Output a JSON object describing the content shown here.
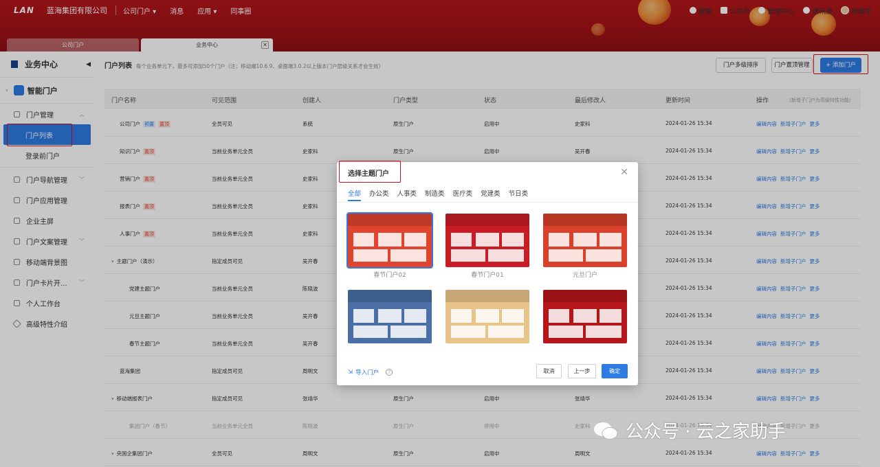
{
  "header": {
    "logo": "LAN",
    "company": "蓝海集团有限公司",
    "nav": [
      "公司门户 ▾",
      "消息",
      "应用 ▾",
      "同事圈"
    ],
    "right": {
      "search": "搜索",
      "public": "公共号",
      "admin": "管理中心",
      "contacts": "通讯录",
      "user": "杨瀚宇"
    },
    "tabs": {
      "company_portal": "公司门户",
      "business_center": "业务中心"
    }
  },
  "sidebar": {
    "title": "业务中心",
    "app": "智能门户",
    "portal_mgmt": "门户管理",
    "portal_list": "门户列表",
    "login_portal": "登录前门户",
    "items": [
      "门户导航管理",
      "门户应用管理",
      "企业主屏",
      "门户文案管理",
      "移动端背景图",
      "门户卡片开...",
      "个人工作台",
      "高级特性介绍"
    ]
  },
  "main": {
    "title": "门户列表",
    "note": "每个业务单元下，最多可添加50个门户（注：移动端10.6.9、桌面端3.0.2以上版本门户层级关系才会生效）",
    "btn_sort": "门户多级排序",
    "btn_top": "门户置顶管理",
    "btn_add": "+ 添加门户",
    "columns": [
      "门户名称",
      "可见范围",
      "创建人",
      "门户类型",
      "状态",
      "最后修改人",
      "更新时间",
      "操作"
    ],
    "ops_note": "（新增子门户为高级特性功能）",
    "actions": [
      "编辑内容",
      "新增子门户",
      "更多"
    ],
    "rows": [
      {
        "name": "公司门户",
        "tags": [
          "预置",
          "置顶"
        ],
        "scope": "全员可见",
        "creator": "系统",
        "type": "原生门户",
        "status": "启用中",
        "modifier": "史家科",
        "time": "2024-01-26 15:34"
      },
      {
        "name": "知识门户",
        "tags": [
          "置顶"
        ],
        "scope": "当前业务单元全员",
        "creator": "史家科",
        "type": "原生门户",
        "status": "启用中",
        "modifier": "吴开春",
        "time": "2024-01-26 15:34"
      },
      {
        "name": "营销门户",
        "tags": [
          "置顶"
        ],
        "scope": "当前业务单元全员",
        "creator": "史家科",
        "type": "",
        "status": "",
        "modifier": "",
        "time": "2024-01-26 15:34"
      },
      {
        "name": "报表门户",
        "tags": [
          "置顶"
        ],
        "scope": "当前业务单元全员",
        "creator": "史家科",
        "type": "",
        "status": "",
        "modifier": "",
        "time": "2024-01-26 15:34"
      },
      {
        "name": "人事门户",
        "tags": [
          "置顶"
        ],
        "scope": "当前业务单元全员",
        "creator": "史家科",
        "type": "",
        "status": "",
        "modifier": "",
        "time": "2024-01-26 15:34"
      },
      {
        "name": "主题门户（演示）",
        "tags": [],
        "scope": "指定成员可见",
        "creator": "吴开春",
        "type": "",
        "status": "",
        "modifier": "",
        "time": "2024-01-26 15:34"
      },
      {
        "name": "党建主题门户",
        "tags": [],
        "scope": "当前业务单元全员",
        "creator": "陈晓波",
        "type": "",
        "status": "",
        "modifier": "",
        "time": "2024-01-26 15:34"
      },
      {
        "name": "元旦主题门户",
        "tags": [],
        "scope": "当前业务单元全员",
        "creator": "吴开春",
        "type": "",
        "status": "",
        "modifier": "",
        "time": "2024-01-26 15:34"
      },
      {
        "name": "春节主题门户",
        "tags": [],
        "scope": "当前业务单元全员",
        "creator": "吴开春",
        "type": "",
        "status": "",
        "modifier": "",
        "time": "2024-01-26 15:34"
      },
      {
        "name": "蓝海集团",
        "tags": [],
        "scope": "指定成员可见",
        "creator": "周明文",
        "type": "",
        "status": "",
        "modifier": "",
        "time": "2024-01-26 15:34"
      },
      {
        "name": "移动端报表门户",
        "tags": [],
        "scope": "指定成员可见",
        "creator": "张靖华",
        "type": "原生门户",
        "status": "启用中",
        "modifier": "张靖华",
        "time": "2024-01-26 15:34"
      },
      {
        "name": "集团门户（春节）",
        "tags": [],
        "scope": "当前业务单元全员",
        "creator": "陈晓波",
        "type": "原生门户",
        "status": "停用中",
        "modifier": "史家科",
        "time": "2024-01-26 15:34"
      },
      {
        "name": "央国企集团门户",
        "tags": [],
        "scope": "全员可见",
        "creator": "周明文",
        "type": "原生门户",
        "status": "启用中",
        "modifier": "周明文",
        "time": "2024-01-26 15:34"
      }
    ]
  },
  "dialog": {
    "title": "选择主题门户",
    "tabs": [
      "全部",
      "办公类",
      "人事类",
      "制造类",
      "医疗类",
      "党建类",
      "节日类"
    ],
    "templates": [
      {
        "caption": "春节门户02",
        "color": "#e0432e"
      },
      {
        "caption": "春节门户01",
        "color": "#c81d25"
      },
      {
        "caption": "元旦门户",
        "color": "#d9412b"
      },
      {
        "caption": "",
        "color": "#4a6fa5"
      },
      {
        "caption": "",
        "color": "#e9c48a"
      },
      {
        "caption": "",
        "color": "#b5161b"
      }
    ],
    "import": "导入门户",
    "help": "?",
    "cancel": "取消",
    "prev": "上一步",
    "ok": "确定"
  },
  "watermark": "公众号 · 云之家助手"
}
